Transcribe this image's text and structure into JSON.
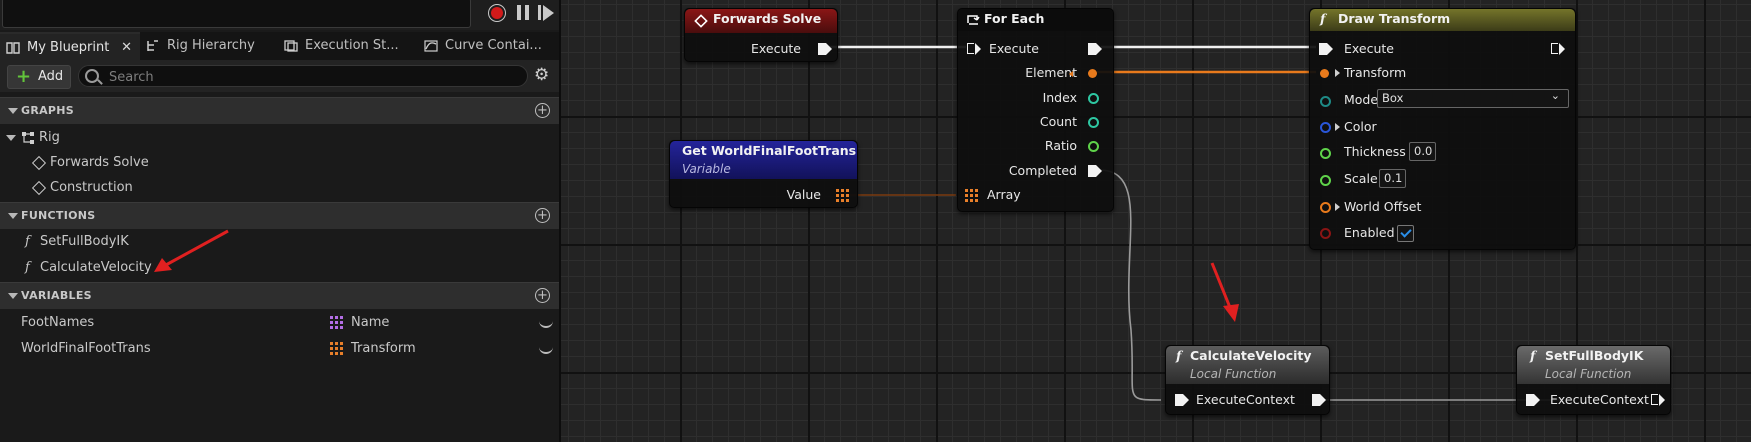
{
  "toolbar": {
    "record_label": "record",
    "pause_label": "pause",
    "step_label": "step"
  },
  "tabs": [
    {
      "label": "My Blueprint",
      "close": "✕",
      "icon": "blueprint-icon"
    },
    {
      "label": "Rig Hierarchy",
      "icon": "hierarchy-icon"
    },
    {
      "label": "Execution St...",
      "icon": "execution-stack-icon"
    },
    {
      "label": "Curve Contai...",
      "icon": "curve-icon"
    }
  ],
  "panel_toolbar": {
    "add_label": "Add",
    "search_placeholder": "Search"
  },
  "sections": {
    "graphs": {
      "title": "GRAPHS",
      "items": [
        "Rig",
        "Forwards Solve",
        "Construction"
      ]
    },
    "functions": {
      "title": "FUNCTIONS",
      "items": [
        "SetFullBodyIK",
        "CalculateVelocity"
      ]
    },
    "variables": {
      "title": "VARIABLES",
      "items": [
        {
          "name": "FootNames",
          "type": "Name",
          "type_color": "#b46ee6"
        },
        {
          "name": "WorldFinalFootTrans",
          "type": "Transform",
          "type_color": "#e87f2a"
        }
      ]
    }
  },
  "graph": {
    "forwards_solve": {
      "title": "Forwards Solve",
      "execute": "Execute",
      "header_color": "#7a1212"
    },
    "for_each": {
      "title": "For Each",
      "execute": "Execute",
      "element": "Element",
      "index": "Index",
      "count": "Count",
      "ratio": "Ratio",
      "completed": "Completed",
      "array": "Array"
    },
    "get_var": {
      "title": "Get WorldFinalFootTrans",
      "subtitle": "Variable",
      "value": "Value",
      "header_color": "#1b1b80"
    },
    "draw_transform": {
      "title": "Draw Transform",
      "execute": "Execute",
      "transform": "Transform",
      "mode": "Mode",
      "mode_value": "Box",
      "color": "Color",
      "thickness": "Thickness",
      "thickness_value": "0.0",
      "scale": "Scale",
      "scale_value": "0.1",
      "world_offset": "World Offset",
      "enabled": "Enabled",
      "header_color": "#6a6a22"
    },
    "calc_velocity": {
      "title": "CalculateVelocity",
      "subtitle": "Local Function",
      "pin": "ExecuteContext"
    },
    "set_fullbody": {
      "title": "SetFullBodyIK",
      "subtitle": "Local Function",
      "pin": "ExecuteContext"
    },
    "fn_glyph": "f",
    "annotation_color": "#e02020"
  }
}
